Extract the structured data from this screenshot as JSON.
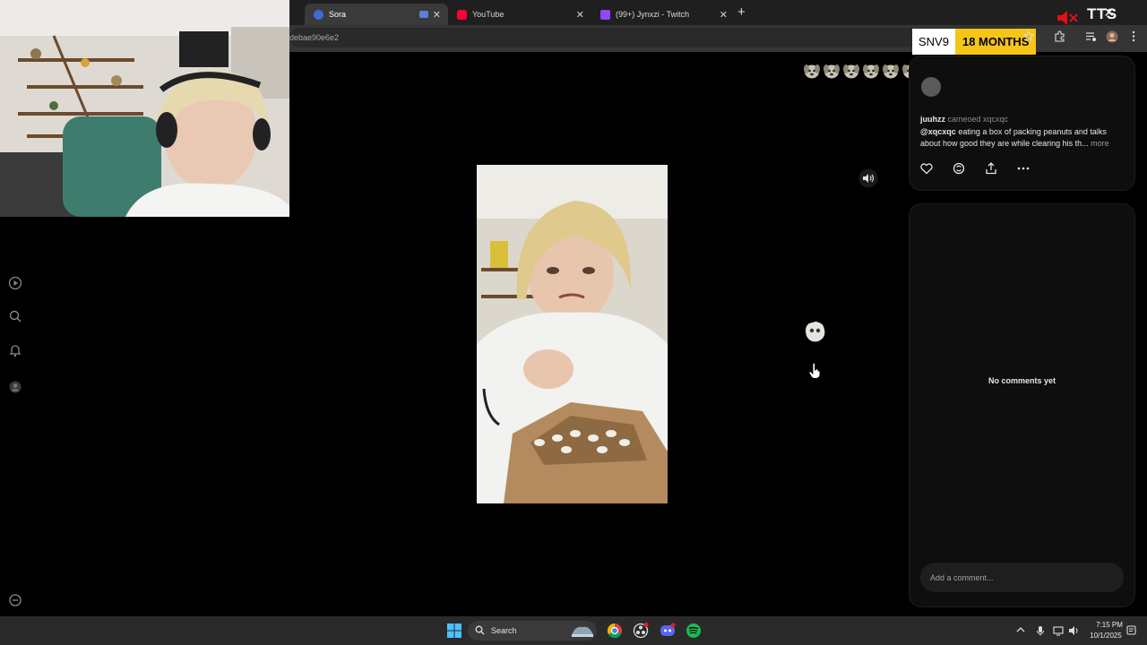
{
  "browser": {
    "tabs": [
      {
        "label": "Sora",
        "active": true,
        "favicon_color": "#3c6bd6"
      },
      {
        "label": "YouTube",
        "active": false,
        "favicon_color": "#ff0033"
      },
      {
        "label": "(99+) Jynxzi - Twitch",
        "active": false,
        "favicon_color": "#9146ff"
      }
    ],
    "url": "debae90e6e2",
    "new_tab": "+",
    "close": "✕"
  },
  "overlay": {
    "tts_label": "TTS",
    "badge_code": "SNV9",
    "badge_duration": "18 MONTHS"
  },
  "post": {
    "author": "juuhzz",
    "action": "cameoed xqcxqc",
    "mention": "@xqcxqc",
    "caption": "eating a box of packing peanuts and talks about how good they are while clearing his th...",
    "more_label": "more"
  },
  "comments": {
    "empty_label": "No comments yet",
    "input_placeholder": "Add a comment..."
  },
  "taskbar": {
    "search_label": "Search",
    "time": "7:15 PM",
    "date": "10/1/2025"
  },
  "colors": {
    "panel": "#0e0e0e",
    "accent_badge": "#f5c518",
    "background": "#000000"
  }
}
